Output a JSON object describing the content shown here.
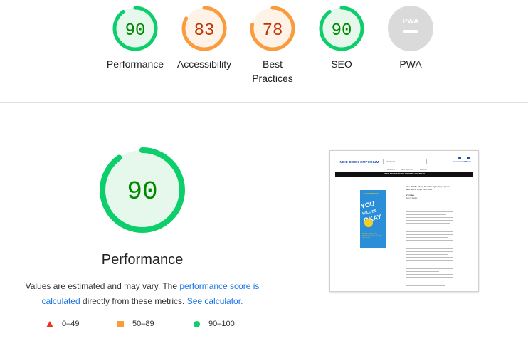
{
  "colors": {
    "pass": "#0cce6b",
    "pass_text": "#008800",
    "pass_bg": "#e6f7ec",
    "average": "#fa9c3e",
    "average_text": "#c33300",
    "average_bg": "#fff3e8",
    "fail": "#eb3223",
    "na": "#cccccc",
    "link": "#1a73e8"
  },
  "summary": {
    "gauges": [
      {
        "label": "Performance",
        "score": "90",
        "value": 90,
        "rating": "pass"
      },
      {
        "label": "Accessibility",
        "score": "83",
        "value": 83,
        "rating": "average"
      },
      {
        "label": "Best Practices",
        "label_line1": "Best",
        "label_line2": "Practices",
        "score": "78",
        "value": 78,
        "rating": "average"
      },
      {
        "label": "SEO",
        "score": "90",
        "value": 90,
        "rating": "pass"
      },
      {
        "label": "PWA",
        "badge": "PWA",
        "rating": "na"
      }
    ]
  },
  "performance": {
    "score": "90",
    "value": 90,
    "title": "Performance",
    "desc_prefix": "Values are estimated and may vary. The ",
    "link_score": "performance score is calculated",
    "desc_middle": " directly from these metrics. ",
    "link_calculator": "See calculator."
  },
  "legend": [
    {
      "icon": "triangle-fail-icon",
      "range": "0–49"
    },
    {
      "icon": "square-average-icon",
      "range": "50–89"
    },
    {
      "icon": "circle-pass-icon",
      "range": "90–100"
    }
  ],
  "thumbnail": {
    "brand": "INDIE BOOK EMPORIUM",
    "search": "SEARCH",
    "account": "MY ACCOUNT",
    "cart": "$0.00",
    "nav": [
      "BOOKS",
      "ALL BOOKS",
      "ABOUT"
    ],
    "banner": "FREE DELIVERY ON ORDERS OVER £30",
    "cover_author": "JULIE STOKES",
    "cover_title_1": "YOU",
    "cover_title_2": "WILL BE",
    "cover_title_3": "OKAY",
    "cover_subtitle": "Find Strength, Stay Hopeful and Get to Grips with Grief",
    "title": "You Will Be Okay: Find Strength, Stay Hopeful and Get to Grips With Grief",
    "price": "£12.99",
    "tag": "Add to basket"
  }
}
